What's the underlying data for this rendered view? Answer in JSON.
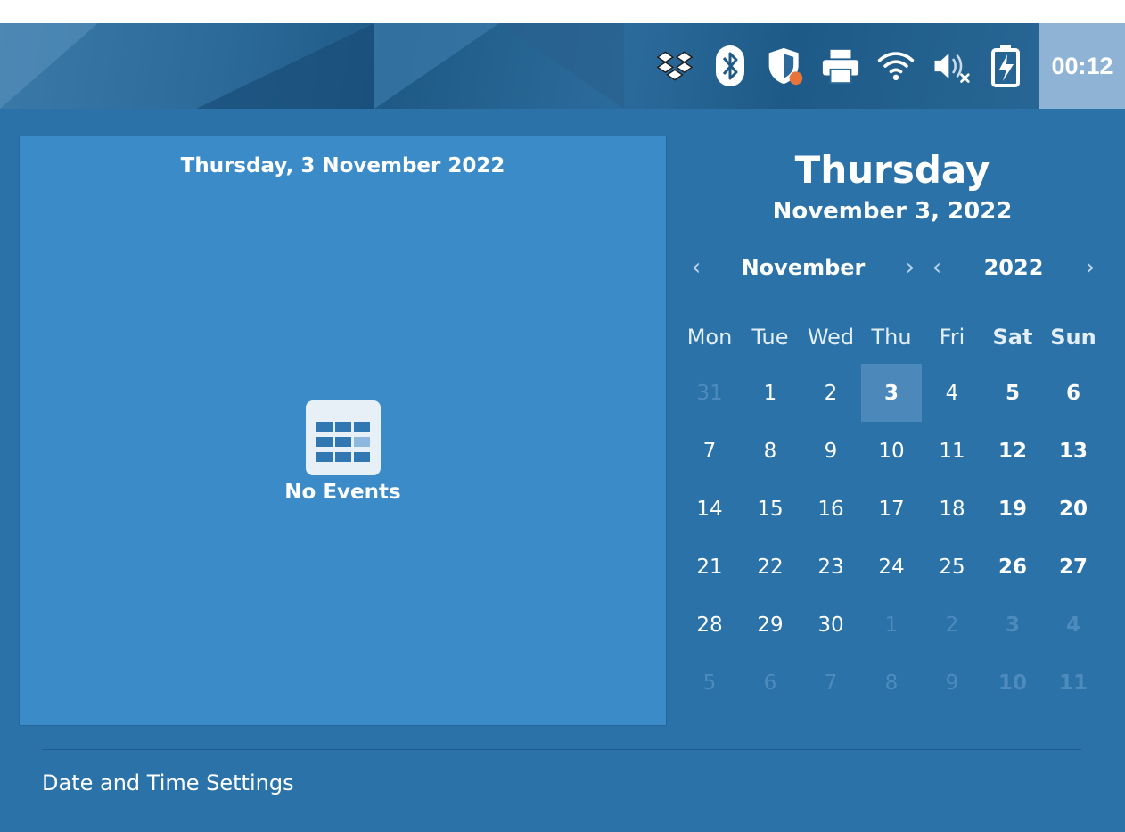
{
  "panel": {
    "tray": [
      {
        "icon": "dropbox-icon"
      },
      {
        "icon": "bluetooth-icon"
      },
      {
        "icon": "security-shield-icon"
      },
      {
        "icon": "printer-icon"
      },
      {
        "icon": "wifi-icon"
      },
      {
        "icon": "volume-muted-icon"
      },
      {
        "icon": "battery-charging-icon"
      }
    ],
    "clock": "00:12"
  },
  "events": {
    "date_heading": "Thursday, 3 November 2022",
    "empty_label": "No Events",
    "empty_icon": "calendar-grid-icon"
  },
  "calendar": {
    "day_name": "Thursday",
    "full_date": "November 3, 2022",
    "month": "November",
    "year": "2022",
    "prev_icon": "chevron-left-icon",
    "next_icon": "chevron-right-icon",
    "weekdays": [
      "Mon",
      "Tue",
      "Wed",
      "Thu",
      "Fri",
      "Sat",
      "Sun"
    ],
    "weeks": [
      [
        "31",
        "1",
        "2",
        "3",
        "4",
        "5",
        "6"
      ],
      [
        "7",
        "8",
        "9",
        "10",
        "11",
        "12",
        "13"
      ],
      [
        "14",
        "15",
        "16",
        "17",
        "18",
        "19",
        "20"
      ],
      [
        "21",
        "22",
        "23",
        "24",
        "25",
        "26",
        "27"
      ],
      [
        "28",
        "29",
        "30",
        "1",
        "2",
        "3",
        "4"
      ],
      [
        "5",
        "6",
        "7",
        "8",
        "9",
        "10",
        "11"
      ]
    ],
    "selected_day": "3"
  },
  "footer": {
    "settings_label": "Date and Time Settings"
  },
  "colors": {
    "popup_bg": "#2a72a8",
    "events_bg": "#3a8bc7",
    "today_bg": "#4c88ba",
    "clock_bg": "#8fb3d4",
    "shield_badge": "#e8743b"
  }
}
